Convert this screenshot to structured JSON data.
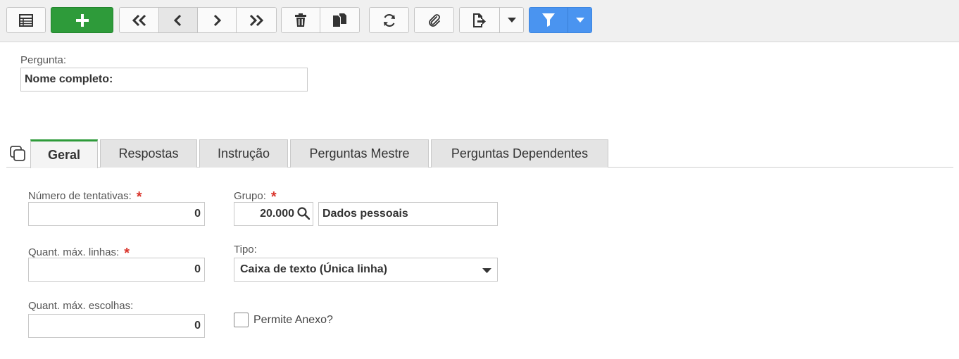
{
  "toolbar": {
    "buttons": [
      {
        "name": "list-view",
        "icon": "table-list-icon"
      },
      {
        "name": "add",
        "icon": "plus-icon"
      },
      {
        "name": "first",
        "icon": "double-chevron-left-icon"
      },
      {
        "name": "previous",
        "icon": "chevron-left-icon"
      },
      {
        "name": "next",
        "icon": "chevron-right-icon"
      },
      {
        "name": "last",
        "icon": "double-chevron-right-icon"
      },
      {
        "name": "delete",
        "icon": "trash-icon"
      },
      {
        "name": "duplicate",
        "icon": "copy-documents-icon"
      },
      {
        "name": "refresh",
        "icon": "refresh-icon"
      },
      {
        "name": "attach",
        "icon": "paperclip-icon"
      },
      {
        "name": "export",
        "icon": "file-export-icon"
      },
      {
        "name": "export-menu",
        "icon": "caret-down-icon"
      },
      {
        "name": "filter",
        "icon": "filter-icon"
      },
      {
        "name": "filter-menu",
        "icon": "caret-down-icon"
      }
    ],
    "colors": {
      "add": "#2e9b3a",
      "filter": "#4a94f0"
    }
  },
  "header": {
    "question_label": "Pergunta:",
    "question_value": "Nome completo:"
  },
  "tabs": [
    {
      "label": "Geral",
      "active": true
    },
    {
      "label": "Respostas",
      "active": false
    },
    {
      "label": "Instrução",
      "active": false
    },
    {
      "label": "Perguntas Mestre",
      "active": false
    },
    {
      "label": "Perguntas Dependentes",
      "active": false
    }
  ],
  "form": {
    "attempts": {
      "label": "Número de tentativas:",
      "required_mark": "*",
      "value": "0"
    },
    "max_lines": {
      "label": "Quant. máx. linhas:",
      "required_mark": "*",
      "value": "0"
    },
    "max_choices": {
      "label": "Quant. máx. escolhas:",
      "value": "0"
    },
    "group": {
      "label": "Grupo:",
      "required_mark": "*",
      "code": "20.000",
      "name": "Dados pessoais"
    },
    "type": {
      "label": "Tipo:",
      "value": "Caixa de texto (Única linha)"
    },
    "allow_attachment": {
      "label": "Permite Anexo?",
      "checked": false
    }
  }
}
